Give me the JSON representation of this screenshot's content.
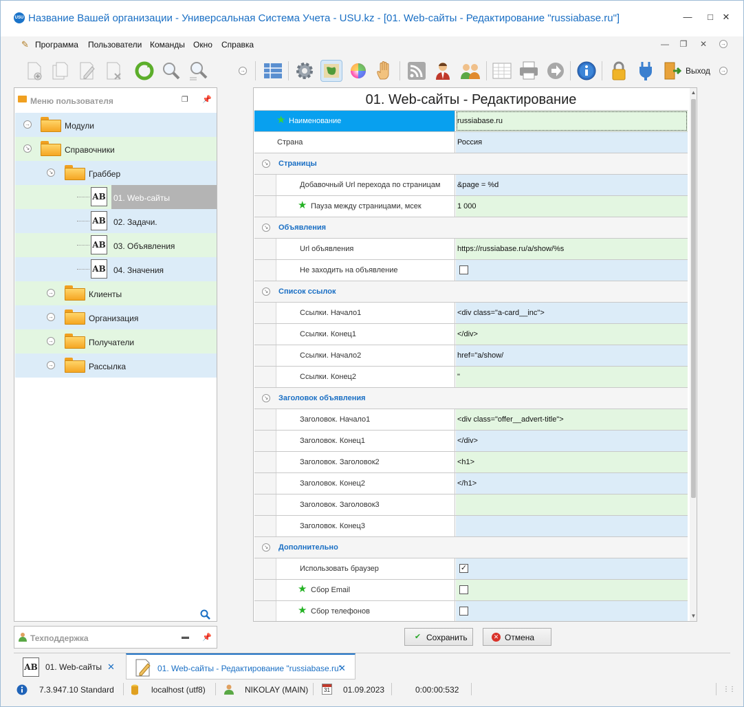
{
  "window": {
    "title": "Название Вашей организации - Универсальная Система Учета - USU.kz - [01. Web-сайты - Редактирование \"russiabase.ru\"]",
    "logo_text": "USU"
  },
  "menu": [
    "Программа",
    "Пользователи",
    "Команды",
    "Окно",
    "Справка"
  ],
  "toolbar": {
    "exit_label": "Выход"
  },
  "left_panel": {
    "title": "Меню пользователя",
    "tree": [
      {
        "label": "Модули"
      },
      {
        "label": "Справочники"
      },
      {
        "label": "Граббер"
      },
      {
        "label": "01. Web-сайты"
      },
      {
        "label": "02. Задачи."
      },
      {
        "label": "03. Объявления"
      },
      {
        "label": "04. Значения"
      },
      {
        "label": "Клиенты"
      },
      {
        "label": "Организация"
      },
      {
        "label": "Получатели"
      },
      {
        "label": "Рассылка"
      }
    ],
    "ab_icon_text": "AB"
  },
  "support_panel": {
    "title": "Техподдержка"
  },
  "form": {
    "title": "01. Web-сайты - Редактирование",
    "fields": {
      "name": {
        "label": "Наименование",
        "value": "russiabase.ru"
      },
      "country": {
        "label": "Страна",
        "value": "Россия"
      }
    },
    "sections": {
      "pages": {
        "title": "Страницы",
        "rows": [
          {
            "label": "Добавочный Url перехода по страницам",
            "value": "&page = %d"
          },
          {
            "label": "Пауза между страницами, мсек",
            "value": "1 000"
          }
        ]
      },
      "ads": {
        "title": "Объявления",
        "rows": [
          {
            "label": "Url объявления",
            "value": "https://russiabase.ru/a/show/%s"
          },
          {
            "label": "Не заходить на объявление",
            "checked": false
          }
        ]
      },
      "links": {
        "title": "Список ссылок",
        "rows": [
          {
            "label": "Ссылки. Начало1",
            "value": "<div class=\"a-card__inc\">"
          },
          {
            "label": "Ссылки. Конец1",
            "value": "</div>"
          },
          {
            "label": "Ссылки. Начало2",
            "value": "href=\"a/show/"
          },
          {
            "label": "Ссылки. Конец2",
            "value": "\""
          }
        ]
      },
      "header": {
        "title": "Заголовок объявления",
        "rows": [
          {
            "label": "Заголовок. Начало1",
            "value": "<div class=\"offer__advert-title\">"
          },
          {
            "label": "Заголовок. Конец1",
            "value": "</div>"
          },
          {
            "label": "Заголовок. Заголовок2",
            "value": "<h1>"
          },
          {
            "label": "Заголовок. Конец2",
            "value": "</h1>"
          },
          {
            "label": "Заголовок. Заголовок3",
            "value": ""
          },
          {
            "label": "Заголовок. Конец3",
            "value": ""
          }
        ]
      },
      "extra": {
        "title": "Дополнительно",
        "rows": [
          {
            "label": "Использовать браузер",
            "checked": true
          },
          {
            "label": "Сбор Email",
            "checked": false
          },
          {
            "label": "Сбор телефонов",
            "checked": false
          }
        ]
      }
    }
  },
  "buttons": {
    "save": "Сохранить",
    "cancel": "Отмена"
  },
  "tabs": [
    {
      "label": "01. Web-сайты"
    },
    {
      "label": "01. Web-сайты - Редактирование \"russiabase.ru\""
    }
  ],
  "status": {
    "version": "7.3.947.10 Standard",
    "db": "localhost (utf8)",
    "user": "NIKOLAY (MAIN)",
    "date": "01.09.2023",
    "timer": "0:00:00:532",
    "calendar_day": "31"
  },
  "colors": {
    "accent": "#1a6fc4",
    "selected": "#08a0ef",
    "row_green": "#e3f6e1",
    "row_blue": "#dcecf8"
  }
}
